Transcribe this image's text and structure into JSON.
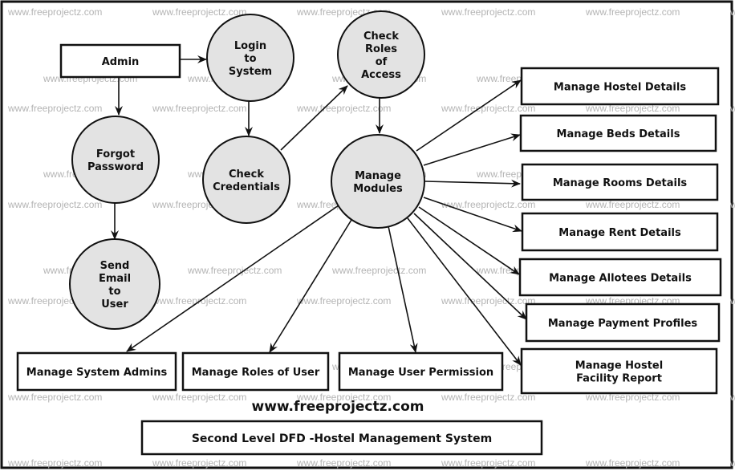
{
  "diagram": {
    "type": "Data Flow Diagram (Level 2)",
    "title": "Second Level DFD -Hostel Management System",
    "website": "www.freeprojectz.com",
    "watermark": "www.freeprojectz.com",
    "entities": [
      {
        "id": "admin",
        "label": "Admin"
      },
      {
        "id": "hostel",
        "label": "Manage Hostel Details"
      },
      {
        "id": "beds",
        "label": "Manage Beds Details"
      },
      {
        "id": "rooms",
        "label": "Manage Rooms Details"
      },
      {
        "id": "rent",
        "label": "Manage Rent Details"
      },
      {
        "id": "allotees",
        "label": "Manage Allotees Details"
      },
      {
        "id": "payment",
        "label": "Manage Payment Profiles"
      },
      {
        "id": "facility",
        "label": "Manage Hostel\nFacility Report"
      },
      {
        "id": "sysadmins",
        "label": "Manage System Admins"
      },
      {
        "id": "roles",
        "label": "Manage Roles of User"
      },
      {
        "id": "permission",
        "label": "Manage User Permission"
      }
    ],
    "processes": [
      {
        "id": "login",
        "label": "Login\nto\nSystem"
      },
      {
        "id": "checkroles",
        "label": "Check\nRoles\nof\nAccess"
      },
      {
        "id": "forgot",
        "label": "Forgot\nPassword"
      },
      {
        "id": "checkcred",
        "label": "Check\nCredentials"
      },
      {
        "id": "modules",
        "label": "Manage\nModules"
      },
      {
        "id": "email",
        "label": "Send\nEmail\nto\nUser"
      }
    ],
    "flows": [
      {
        "from": "admin",
        "to": "login"
      },
      {
        "from": "admin",
        "to": "forgot"
      },
      {
        "from": "forgot",
        "to": "email"
      },
      {
        "from": "login",
        "to": "checkcred"
      },
      {
        "from": "checkcred",
        "to": "checkroles"
      },
      {
        "from": "checkroles",
        "to": "modules"
      },
      {
        "from": "modules",
        "to": "hostel"
      },
      {
        "from": "modules",
        "to": "beds"
      },
      {
        "from": "modules",
        "to": "rooms"
      },
      {
        "from": "modules",
        "to": "rent"
      },
      {
        "from": "modules",
        "to": "allotees"
      },
      {
        "from": "modules",
        "to": "payment"
      },
      {
        "from": "modules",
        "to": "facility"
      },
      {
        "from": "modules",
        "to": "sysadmins"
      },
      {
        "from": "modules",
        "to": "roles"
      },
      {
        "from": "modules",
        "to": "permission"
      }
    ]
  }
}
